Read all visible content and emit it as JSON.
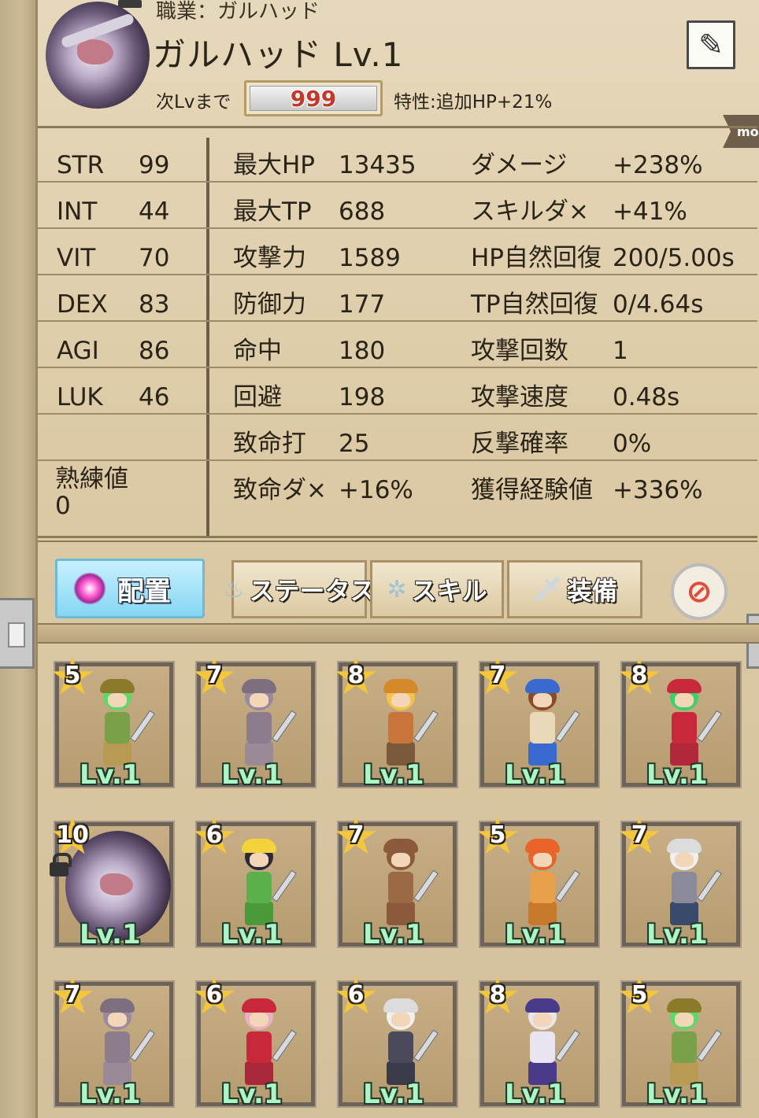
{
  "header": {
    "job_line": "職業：ガルハッド",
    "name_level": "ガルハッド Lv.1",
    "next_lv_label": "次Lvまで",
    "next_lv_value": "999",
    "trait": "特性:追加HP+21%",
    "more_label": "more"
  },
  "stats": {
    "base": [
      {
        "label": "STR",
        "value": "99"
      },
      {
        "label": "INT",
        "value": "44"
      },
      {
        "label": "VIT",
        "value": "70"
      },
      {
        "label": "DEX",
        "value": "83"
      },
      {
        "label": "AGI",
        "value": "86"
      },
      {
        "label": "LUK",
        "value": "46"
      }
    ],
    "proficiency_label": "熟練値",
    "proficiency_value": "0",
    "middle": [
      {
        "label": "最大HP",
        "value": "13435"
      },
      {
        "label": "最大TP",
        "value": "688"
      },
      {
        "label": "攻撃力",
        "value": "1589"
      },
      {
        "label": "防御力",
        "value": "177"
      },
      {
        "label": "命中",
        "value": "180"
      },
      {
        "label": "回避",
        "value": "198"
      },
      {
        "label": "致命打",
        "value": "25"
      },
      {
        "label": "致命ダ×",
        "value": "+16%"
      }
    ],
    "right": [
      {
        "label": "ダメージ",
        "value": "+238%"
      },
      {
        "label": "スキルダ×",
        "value": "+41%"
      },
      {
        "label": "HP自然回復",
        "value": "200/5.00s"
      },
      {
        "label": "TP自然回復",
        "value": "0/4.64s"
      },
      {
        "label": "攻撃回数",
        "value": "1"
      },
      {
        "label": "攻撃速度",
        "value": "0.48s"
      },
      {
        "label": "反撃確率",
        "value": "0%"
      },
      {
        "label": "獲得経験値",
        "value": "+336%"
      }
    ]
  },
  "tabs": {
    "deploy": "配置",
    "status": "ステータス",
    "skill": "スキル",
    "equip": "装備"
  },
  "roster": [
    {
      "stars": "5",
      "level": "Lv.1",
      "hair": "#5fd86a",
      "hat": "#8a7a2a",
      "body": "#7aa04a",
      "legs": "#b89a52"
    },
    {
      "stars": "7",
      "level": "Lv.1",
      "hair": "#9a8aa0",
      "hat": "#7d6e80",
      "body": "#8d7d8c",
      "legs": "#9a8a98"
    },
    {
      "stars": "8",
      "level": "Lv.1",
      "hair": "#f5c14a",
      "hat": "#d48a2a",
      "body": "#c9743a",
      "legs": "#7a5a3a"
    },
    {
      "stars": "7",
      "level": "Lv.1",
      "hair": "#8a4a2a",
      "hat": "#3a6ad0",
      "body": "#e9d9b8",
      "legs": "#3a6ad0"
    },
    {
      "stars": "8",
      "level": "Lv.1",
      "hair": "#3ad06a",
      "hat": "#c8283a",
      "body": "#c8283a",
      "legs": "#b0283a"
    },
    {
      "stars": "10",
      "level": "Lv.1",
      "locked": true
    },
    {
      "stars": "6",
      "level": "Lv.1",
      "hair": "#2a2a3a",
      "hat": "#f3d23a",
      "body": "#5ab04a",
      "legs": "#4a9a3a"
    },
    {
      "stars": "7",
      "level": "Lv.1",
      "hair": "#8a5a3a",
      "hat": "#8a5a3a",
      "body": "#9a6a44",
      "legs": "#8a5a3a"
    },
    {
      "stars": "5",
      "level": "Lv.1",
      "hair": "#e8642a",
      "hat": "#e8642a",
      "body": "#e9a04a",
      "legs": "#c8782a"
    },
    {
      "stars": "7",
      "level": "Lv.1",
      "hair": "#f0f0f0",
      "hat": "#dcdcdc",
      "body": "#8a8a9a",
      "legs": "#3a4a6a"
    },
    {
      "stars": "7",
      "level": "Lv.1",
      "hair": "#9a8aa0",
      "hat": "#7d6e80",
      "body": "#8d7d8c",
      "legs": "#9a8a98"
    },
    {
      "stars": "6",
      "level": "Lv.1",
      "hair": "#e8b0c0",
      "hat": "#c8283a",
      "body": "#c8283a",
      "legs": "#a8283a"
    },
    {
      "stars": "6",
      "level": "Lv.1",
      "hair": "#f0f0f0",
      "hat": "#dcdcdc",
      "body": "#4a4a5a",
      "legs": "#3a3a4a"
    },
    {
      "stars": "8",
      "level": "Lv.1",
      "hair": "#e8e4f0",
      "hat": "#4a3a8a",
      "body": "#e8e4f0",
      "legs": "#4a3a8a"
    },
    {
      "stars": "5",
      "level": "Lv.1",
      "hair": "#5fd86a",
      "hat": "#8a7a2a",
      "body": "#7aa04a",
      "legs": "#b89a52"
    }
  ]
}
